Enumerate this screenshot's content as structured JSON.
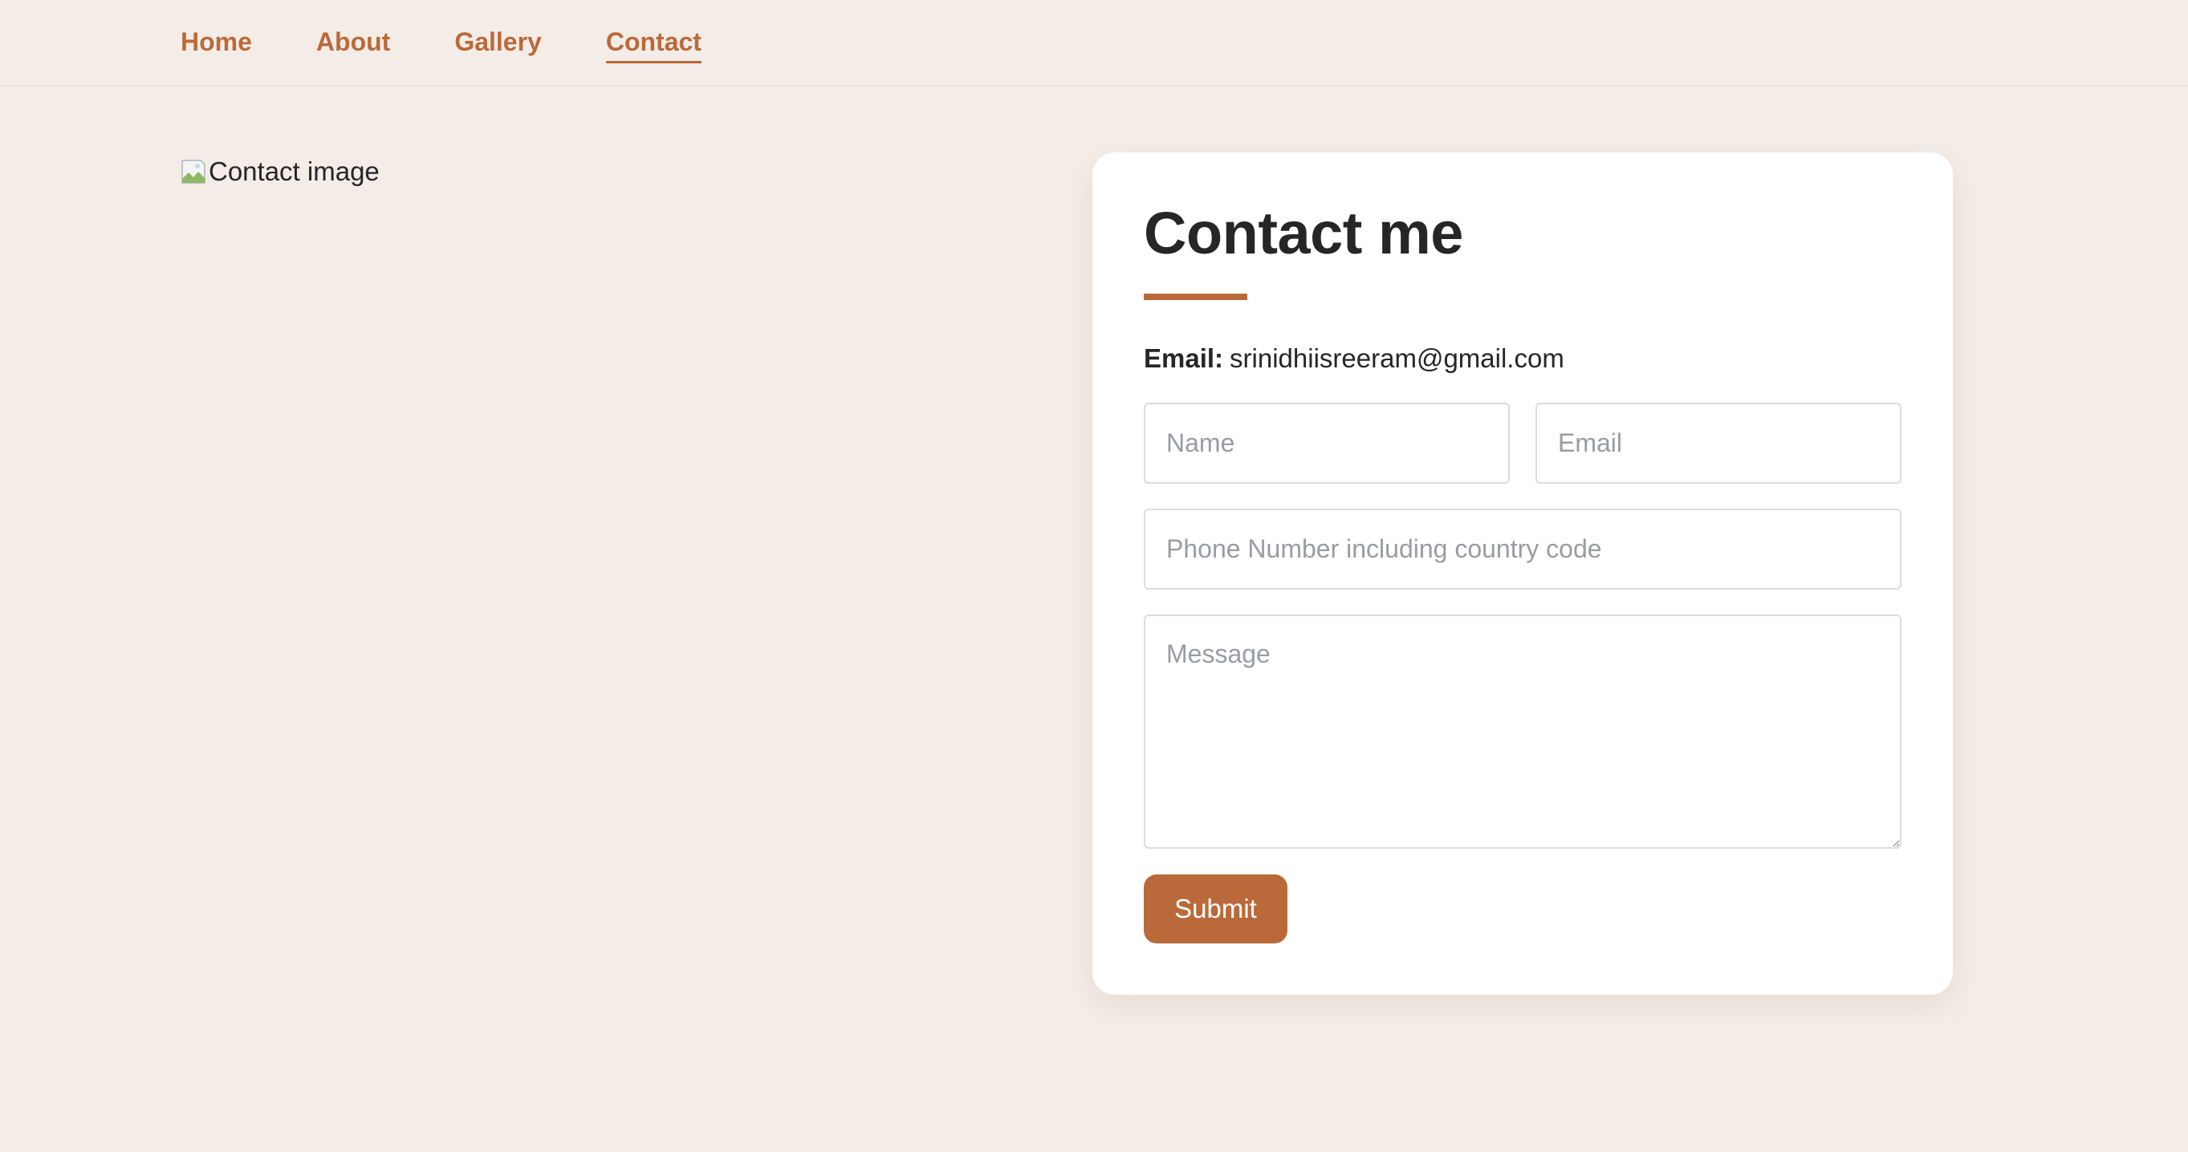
{
  "nav": {
    "items": [
      {
        "label": "Home",
        "active": false
      },
      {
        "label": "About",
        "active": false
      },
      {
        "label": "Gallery",
        "active": false
      },
      {
        "label": "Contact",
        "active": true
      }
    ]
  },
  "hero_image": {
    "alt_text": "Contact image"
  },
  "contact_card": {
    "title": "Contact me",
    "email_label": "Email:",
    "email_value": "srinidhiisreeram@gmail.com",
    "form": {
      "name_placeholder": "Name",
      "email_placeholder": "Email",
      "phone_placeholder": "Phone Number including country code",
      "message_placeholder": "Message",
      "submit_label": "Submit"
    }
  },
  "colors": {
    "accent": "#ba6a3a",
    "page_background": "#f4ece6",
    "card_background": "#ffffff",
    "text": "#262626",
    "placeholder": "#9a9ba3"
  }
}
